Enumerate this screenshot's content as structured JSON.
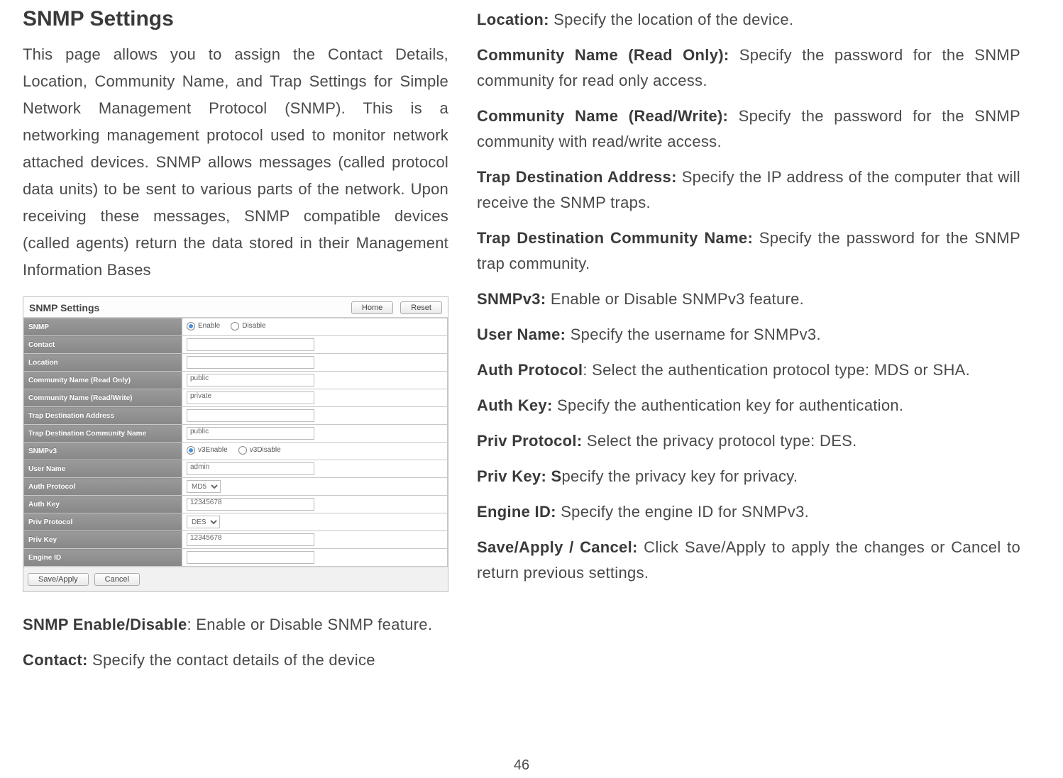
{
  "page_number": "46",
  "left": {
    "heading": "SNMP Settings",
    "intro": "This page allows you to assign the Contact Details, Location, Community Name, and Trap Settings for Simple Network Management Protocol (SNMP). This is a networking management protocol used to monitor network attached devices. SNMP allows messages (called protocol data units) to be sent to various parts of the network. Upon receiving these messages, SNMP compatible devices (called agents) return the data stored in their Management Information Bases",
    "item1_label": "SNMP Enable/Disable",
    "item1_text": ": Enable or Disable SNMP feature.",
    "item2_label": "Contact:",
    "item2_text": " Specify the contact details of the device"
  },
  "right": {
    "r1_label": "Location:",
    "r1_text": " Specify the location of the device.",
    "r2_label": "Community Name (Read Only):",
    "r2_text": " Specify the password for the SNMP community for read only access.",
    "r3_label": "Community Name (Read/Write):",
    "r3_text": " Specify the password for the SNMP community with read/write access.",
    "r4_label": "Trap Destination Address:",
    "r4_text": " Specify the IP address of the computer that will receive the SNMP traps.",
    "r5_label": "Trap Destination Community Name:",
    "r5_text": " Specify the password for the SNMP trap community.",
    "r6_label": "SNMPv3:",
    "r6_text": " Enable or Disable SNMPv3 feature.",
    "r7_label": "User Name:",
    "r7_text": " Specify the username for SNMPv3.",
    "r8_label": "Auth Protocol",
    "r8_text": ": Select the authentication protocol type: MDS or SHA.",
    "r9_label": "Auth Key:",
    "r9_text": " Specify the authentication key for authentication.",
    "r10_label": "Priv Protocol:",
    "r10_text": " Select the privacy protocol type: DES.",
    "r11_label": "Priv Key: S",
    "r11_text": "pecify the privacy key for privacy.",
    "r12_label": "Engine ID:",
    "r12_text": " Specify the engine ID for SNMPv3.",
    "r13_label": "Save/Apply / Cancel:",
    "r13_text": " Click Save/Apply to apply the changes or Cancel to return previous settings."
  },
  "shot": {
    "title": "SNMP Settings",
    "home": "Home",
    "reset": "Reset",
    "rows": {
      "snmp": "SNMP",
      "enable": "Enable",
      "disable": "Disable",
      "contact": "Contact",
      "location": "Location",
      "cro": "Community Name (Read Only)",
      "cro_val": "public",
      "crw": "Community Name (Read/Write)",
      "crw_val": "private",
      "tda": "Trap Destination Address",
      "tdcn": "Trap Destination Community Name",
      "tdcn_val": "public",
      "v3": "SNMPv3",
      "v3en": "v3Enable",
      "v3dis": "v3Disable",
      "uname": "User Name",
      "uname_val": "admin",
      "aprot": "Auth Protocol",
      "aprot_val": "MD5",
      "akey": "Auth Key",
      "akey_val": "12345678",
      "pprot": "Priv Protocol",
      "pprot_val": "DES",
      "pkey": "Priv Key",
      "pkey_val": "12345678",
      "eid": "Engine ID"
    },
    "save": "Save/Apply",
    "cancel": "Cancel"
  }
}
